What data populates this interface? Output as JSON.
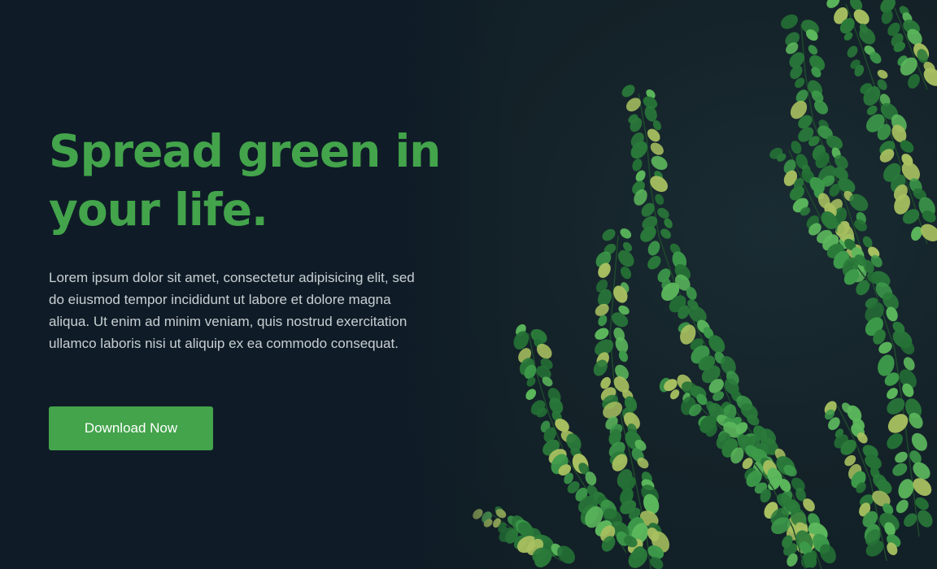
{
  "hero": {
    "headline_line1": "Spread green in",
    "headline_line2": "your life.",
    "body": "Lorem ipsum dolor sit amet, consectetur adipisicing elit, sed do eiusmod tempor incididunt ut labore et dolore magna aliqua. Ut enim ad minim veniam, quis nostrud exercitation ullamco laboris nisi ut aliquip ex ea commodo consequat.",
    "cta_label": "Download Now"
  },
  "colors": {
    "background": "#0f1c27",
    "accent": "#43a44b",
    "body_text": "#c9cfd3",
    "leaf_dark": "#2a7a3a",
    "leaf_light": "#5cb85c",
    "leaf_yellow": "#a8c060"
  }
}
